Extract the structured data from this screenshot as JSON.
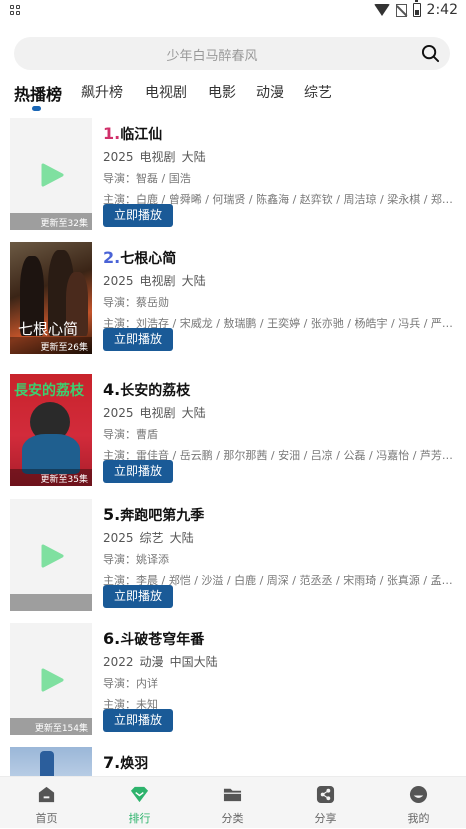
{
  "status_bar": {
    "time": "2:42"
  },
  "search": {
    "placeholder": "少年白马醉春风"
  },
  "tabs": [
    {
      "label": "热播榜"
    },
    {
      "label": "飙升榜"
    },
    {
      "label": "电视剧"
    },
    {
      "label": "电影"
    },
    {
      "label": "动漫"
    },
    {
      "label": "综艺"
    }
  ],
  "items": [
    {
      "rank": "1.",
      "name": "临江仙",
      "year": "2025",
      "type": "电视剧",
      "region": "大陆",
      "director": "导演：智磊 / 国浩",
      "cast": "主演：白鹿 / 曾舜晞 / 何瑞贤 / 陈鑫海 / 赵弈钦 / 周洁琼 / 梁永棋 / 郑凯 / 赵...",
      "badge": "更新至32集",
      "button": "立即播放"
    },
    {
      "rank": "2.",
      "name": "七根心简",
      "year": "2025",
      "type": "电视剧",
      "region": "大陆",
      "director": "导演：蔡岳勋",
      "cast": "主演：刘浩存 / 宋威龙 / 敖瑞鹏 / 王奕婷 / 张亦驰 / 杨皓宇 / 冯兵 / 严屹宽 / ...",
      "badge": "更新至26集",
      "poster_text": "七根心简",
      "button": "立即播放"
    },
    {
      "rank": "4.",
      "name": "长安的荔枝",
      "year": "2025",
      "type": "电视剧",
      "region": "大陆",
      "director": "导演：曹盾",
      "cast": "主演：雷佳音 / 岳云鹏 / 那尔那茜 / 安沺 / 吕凉 / 公磊 / 冯嘉怡 / 芦芳生 / 赵...",
      "badge": "更新至35集",
      "poster_text": "長安的荔枝",
      "button": "立即播放"
    },
    {
      "rank": "5.",
      "name": "奔跑吧第九季",
      "year": "2025",
      "type": "综艺",
      "region": "大陆",
      "director": "导演：姚译添",
      "cast": "主演：李晨 / 郑恺 / 沙溢 / 白鹿 / 周深 / 范丞丞 / 宋雨琦 / 张真源 / 孟子义 / ...",
      "badge": "",
      "button": "立即播放"
    },
    {
      "rank": "6.",
      "name": "斗破苍穹年番",
      "year": "2022",
      "type": "动漫",
      "region": "中国大陆",
      "director": "导演：内详",
      "cast": "主演：未知",
      "badge": "更新至154集",
      "button": "立即播放"
    },
    {
      "rank": "7.",
      "name": "焕羽"
    }
  ],
  "bottom_nav": [
    {
      "label": "首页",
      "icon": "home-icon"
    },
    {
      "label": "排行",
      "icon": "ranking-icon"
    },
    {
      "label": "分类",
      "icon": "folder-icon"
    },
    {
      "label": "分享",
      "icon": "share-icon"
    },
    {
      "label": "我的",
      "icon": "profile-icon"
    }
  ],
  "colors": {
    "accent": "#1a5a97",
    "active_tab": "#2db36c",
    "rank_1": "#d0306a",
    "rank_2": "#4a63d6",
    "placeholder_play": "#7fe0a0"
  }
}
